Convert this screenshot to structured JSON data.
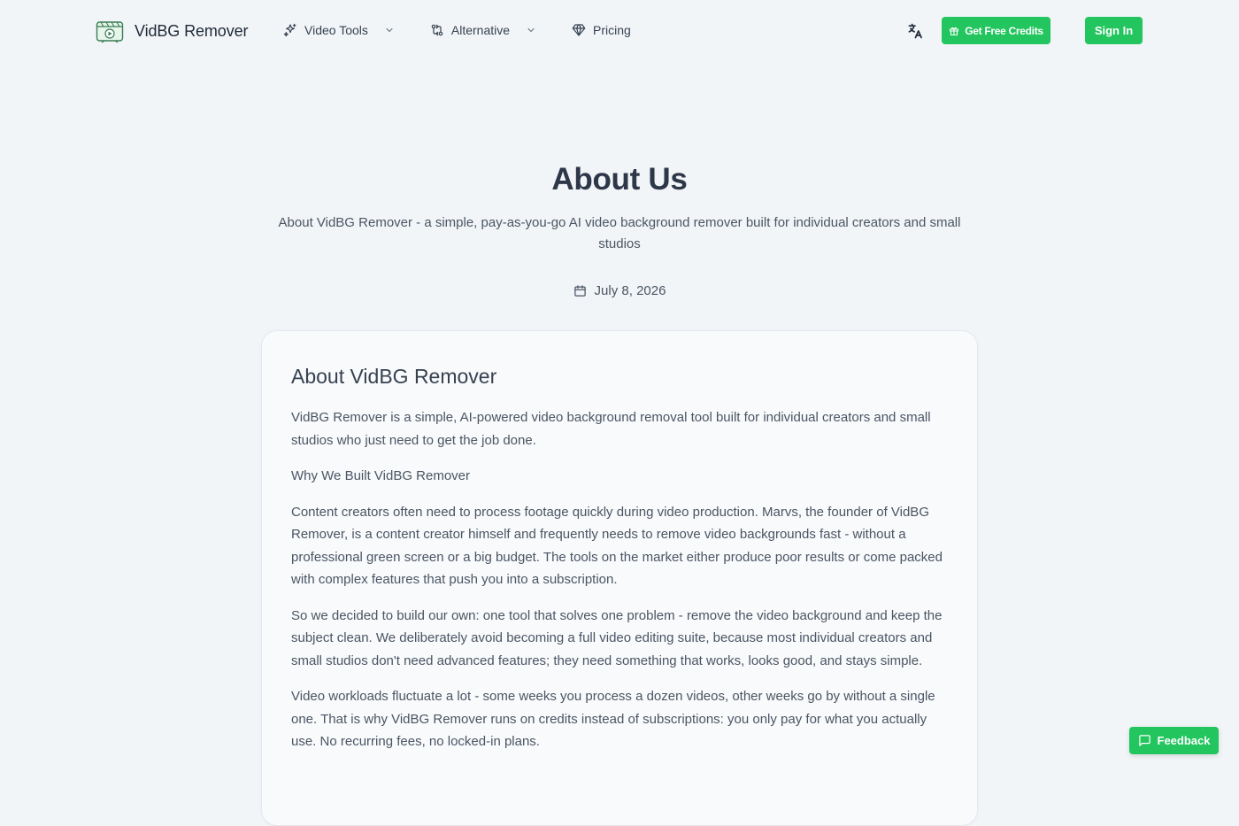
{
  "header": {
    "brand": "VidBG Remover",
    "nav": [
      {
        "label": "Video Tools",
        "icon": "sparkles-icon",
        "dropdown": true
      },
      {
        "label": "Alternative",
        "icon": "git-compare-icon",
        "dropdown": true
      },
      {
        "label": "Pricing",
        "icon": "gem-icon",
        "dropdown": false
      }
    ],
    "language_icon": "language-icon",
    "credits_label": "Get Free Credits",
    "signin_label": "Sign In"
  },
  "hero": {
    "title": "About Us",
    "subtitle": "About VidBG Remover - a simple, pay-as-you-go AI video background remover built for individual creators and small studios",
    "date": "July 8, 2026"
  },
  "article": {
    "title": "About VidBG Remover",
    "paragraphs": [
      "VidBG Remover is a simple, AI-powered video background removal tool built for individual creators and small studios who just need to get the job done.",
      "Why We Built VidBG Remover",
      "Content creators often need to process footage quickly during video production. Marvs, the founder of VidBG Remover, is a content creator himself and frequently needs to remove video backgrounds fast - without a professional green screen or a big budget. The tools on the market either produce poor results or come packed with complex features that push you into a subscription.",
      "So we decided to build our own: one tool that solves one problem - remove the video background and keep the subject clean. We deliberately avoid becoming a full video editing suite, because most individual creators and small studios don't need advanced features; they need something that works, looks good, and stays simple.",
      "Video workloads fluctuate a lot - some weeks you process a dozen videos, other weeks go by without a single one. That is why VidBG Remover runs on credits instead of subscriptions: you only pay for what you actually use. No recurring fees, no locked-in plans."
    ]
  },
  "feedback_label": "Feedback",
  "colors": {
    "accent": "#22c55e",
    "background": "#f1f5f8",
    "card": "#f8fafc",
    "heading": "#2d3748",
    "body_text": "#4b5563"
  }
}
